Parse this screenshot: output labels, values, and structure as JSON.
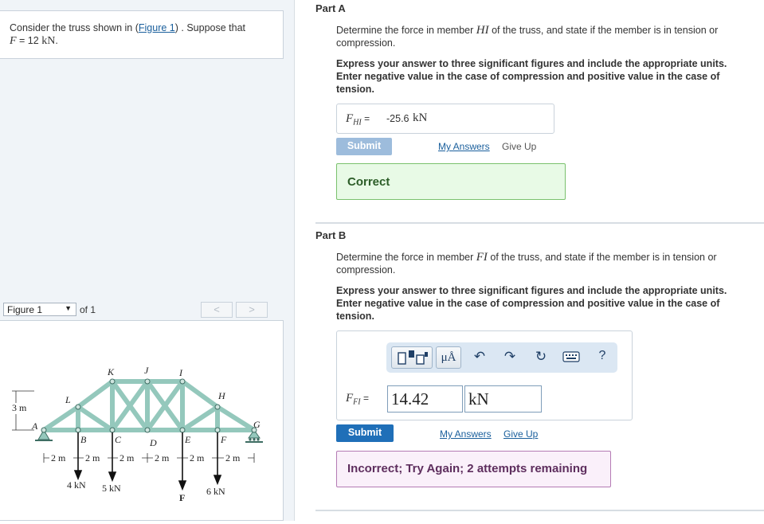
{
  "problem": {
    "text_before": "Consider the truss shown in (",
    "figure_link": "Figure 1",
    "text_after": ") . Suppose that",
    "var": "F",
    "eq": " = 12 ",
    "unit": "kN",
    "period": "."
  },
  "figure_nav": {
    "selected": "Figure 1",
    "of": "of 1",
    "prev": "<",
    "next": ">"
  },
  "figure": {
    "joints": [
      "A",
      "B",
      "C",
      "D",
      "E",
      "F",
      "G",
      "H",
      "I",
      "J",
      "K",
      "L"
    ],
    "height_label": "3 m",
    "spacing_labels": [
      "2 m",
      "2 m",
      "2 m",
      "2 m",
      "2 m",
      "2 m"
    ],
    "loads": [
      "4 kN",
      "5 kN",
      "F",
      "6 kN"
    ]
  },
  "part_a": {
    "title": "Part A",
    "q_before": "Determine the force in member ",
    "q_member": "HI",
    "q_after": " of the truss, and state if the member is in tension or compression.",
    "instructions": "Express your answer to three significant figures and include the appropriate units. Enter negative value in the case of compression and positive value in the case of tension.",
    "answer_var": "F",
    "answer_sub": "HI",
    "answer_eq": "=",
    "answer_value": "-25.6",
    "answer_unit": "kN",
    "submit_label": "Submit",
    "my_answers": "My Answers",
    "give_up": "Give Up",
    "feedback": "Correct"
  },
  "part_b": {
    "title": "Part B",
    "q_before": "Determine the force in member ",
    "q_member": "FI",
    "q_after": " of the truss, and state if the member is in tension or compression.",
    "instructions": "Express your answer to three significant figures and include the appropriate units. Enter negative value in the case of compression and positive value in the case of tension.",
    "answer_var": "F",
    "answer_sub": "FI",
    "answer_eq": "=",
    "value_input": "14.42",
    "unit_input": "kN",
    "toolbar": {
      "mu_label": "μÅ",
      "help": "?"
    },
    "submit_label": "Submit",
    "my_answers": "My Answers",
    "give_up": "Give Up",
    "feedback": "Incorrect; Try Again; 2 attempts remaining"
  },
  "colors": {
    "truss_fill": "#94c8bc",
    "truss_stroke": "#3e6d63",
    "submit_disabled": "#9dbcdc",
    "submit_active": "#1f6fb8",
    "correct_bg": "#e8fae6",
    "incorrect_bg": "#faf0fa"
  }
}
